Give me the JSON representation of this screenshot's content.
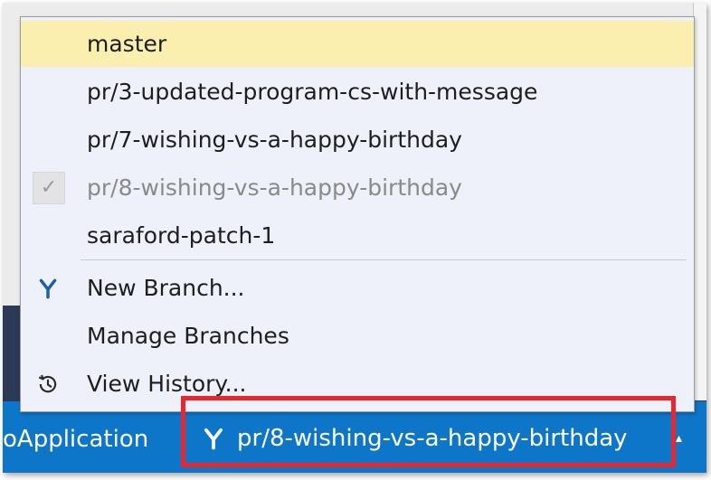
{
  "branch_menu": {
    "branches": [
      {
        "label": "master",
        "state": "highlighted"
      },
      {
        "label": "pr/3-updated-program-cs-with-message",
        "state": "normal"
      },
      {
        "label": "pr/7-wishing-vs-a-happy-birthday",
        "state": "normal"
      },
      {
        "label": "pr/8-wishing-vs-a-happy-birthday",
        "state": "current"
      },
      {
        "label": "saraford-patch-1",
        "state": "normal"
      }
    ],
    "actions": [
      {
        "label": "New Branch...",
        "icon": "branch-icon"
      },
      {
        "label": "Manage Branches",
        "icon": ""
      },
      {
        "label": "View History...",
        "icon": "history-icon"
      }
    ],
    "check_glyph": "✓"
  },
  "status_bar": {
    "project": "oApplication",
    "branch": "pr/8-wishing-vs-a-happy-birthday"
  },
  "colors": {
    "status_bar": "#0e76c8",
    "highlight": "#fbefb0",
    "annotation_box": "#e8262d",
    "menu_background": "#eef0fa"
  }
}
